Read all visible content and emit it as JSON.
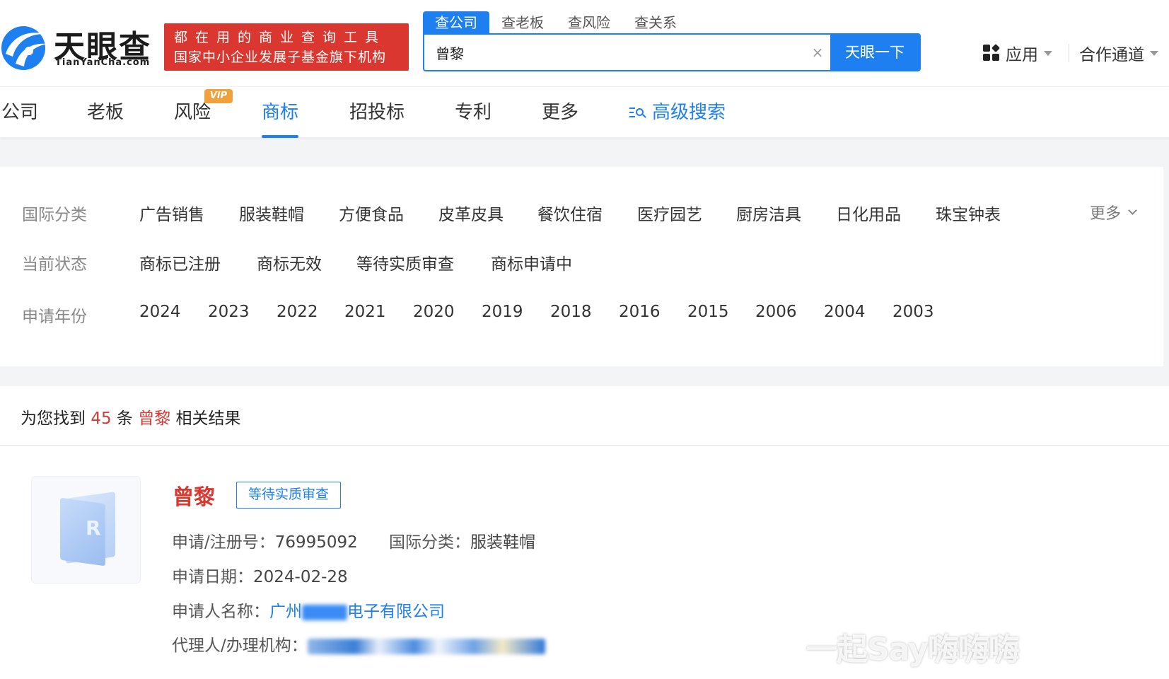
{
  "header": {
    "logo_cn": "天眼查",
    "logo_en": "TianYanCha.com",
    "slogan_line1": "都在用的商业查询工具",
    "slogan_line2": "国家中小企业发展子基金旗下机构",
    "search_tabs": [
      "查公司",
      "查老板",
      "查风险",
      "查关系"
    ],
    "search_value": "曾黎",
    "search_clear": "×",
    "search_button": "天眼一下",
    "apps_label": "应用",
    "partner_label": "合作通道"
  },
  "nav": {
    "items": [
      "公司",
      "老板",
      "风险",
      "商标",
      "招投标",
      "专利",
      "更多"
    ],
    "vip_badge": "VIP",
    "active": "商标",
    "advanced_search": "高级搜索"
  },
  "filters": {
    "class_label": "国际分类",
    "classes": [
      "广告销售",
      "服装鞋帽",
      "方便食品",
      "皮革皮具",
      "餐饮住宿",
      "医疗园艺",
      "厨房洁具",
      "日化用品",
      "珠宝钟表"
    ],
    "more_label": "更多",
    "status_label": "当前状态",
    "statuses": [
      "商标已注册",
      "商标无效",
      "等待实质审查",
      "商标申请中"
    ],
    "year_label": "申请年份",
    "years": [
      "2024",
      "2023",
      "2022",
      "2021",
      "2020",
      "2019",
      "2018",
      "2016",
      "2015",
      "2006",
      "2004",
      "2003"
    ]
  },
  "results": {
    "prefix": "为您找到",
    "count": "45",
    "unit": "条",
    "keyword": "曾黎",
    "suffix": "相关结果"
  },
  "card": {
    "name": "曾黎",
    "status": "等待实质审查",
    "reg_label": "申请/注册号：",
    "reg_value": "76995092",
    "class_label": "国际分类：",
    "class_value": "服装鞋帽",
    "date_label": "申请日期：",
    "date_value": "2024-02-28",
    "applicant_label": "申请人名称：",
    "applicant_start": "广州",
    "applicant_end": "电子有限公司",
    "agent_label": "代理人/办理机构："
  },
  "watermark": "一起Say嗨嗨嗨",
  "colors": {
    "accent": "#1e7ff0",
    "brand_red": "#d9372f",
    "vip": "#f2a03a"
  }
}
